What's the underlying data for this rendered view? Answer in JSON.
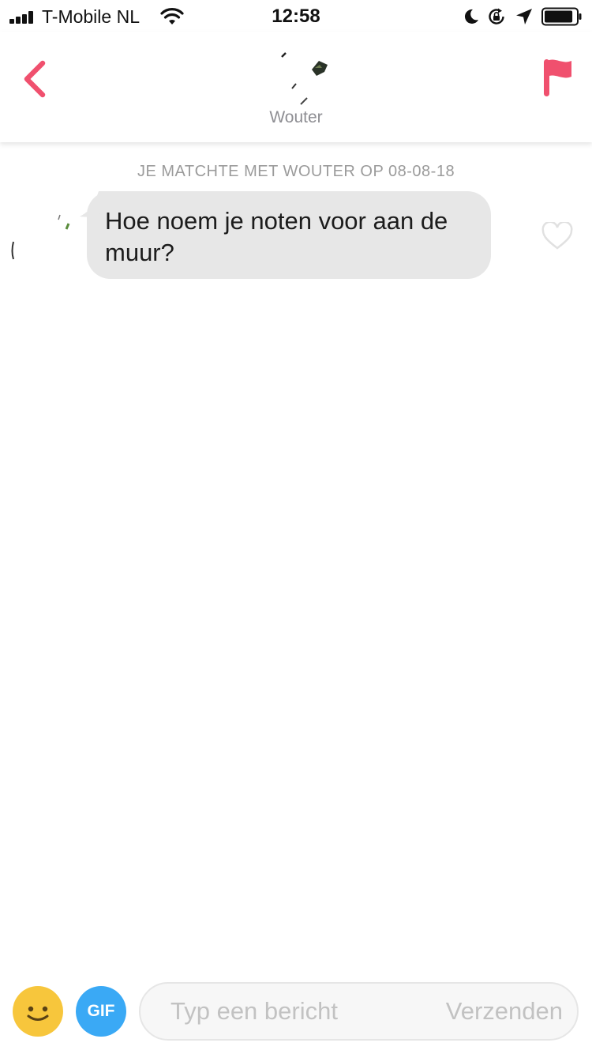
{
  "status_bar": {
    "carrier": "T-Mobile NL",
    "time": "12:58",
    "signal_bars": 4,
    "battery_level": 0.9,
    "icons": [
      "signal-icon",
      "wifi-icon",
      "moon-icon",
      "lock-rotation-icon",
      "location-icon",
      "battery-icon"
    ]
  },
  "header": {
    "back_icon": "chevron-left-icon",
    "profile_name": "Wouter",
    "report_icon": "flag-icon",
    "accent_color": "#f0506e"
  },
  "chat": {
    "match_info": "JE MATCHTE MET WOUTER OP 08-08-18",
    "messages": [
      {
        "text": "Hoe noem je noten voor aan de muur?",
        "liked": false
      }
    ]
  },
  "composer": {
    "emoji_icon": "smiley-icon",
    "gif_label": "GIF",
    "placeholder": "Typ een bericht",
    "value": "",
    "send_label": "Verzenden",
    "emoji_color": "#f7c63c",
    "gif_color": "#3aa9f5"
  }
}
